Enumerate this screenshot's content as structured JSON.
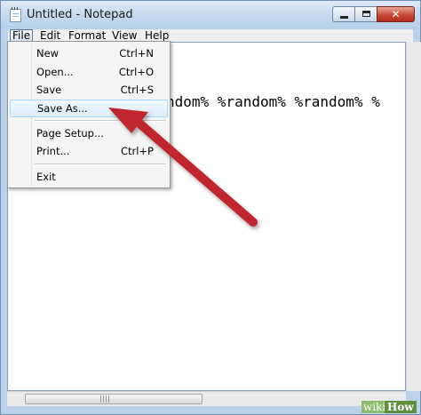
{
  "window": {
    "title": "Untitled - Notepad",
    "icon": "notepad-icon"
  },
  "title_buttons": {
    "minimize_icon": "minimize-icon",
    "maximize_icon": "maximize-icon",
    "close_glyph": "✕"
  },
  "menubar": {
    "items": [
      "File",
      "Edit",
      "Format",
      "View",
      "Help"
    ],
    "active": "File"
  },
  "file_menu": {
    "items": [
      {
        "label": "New",
        "shortcut": "Ctrl+N"
      },
      {
        "label": "Open...",
        "shortcut": "Ctrl+O"
      },
      {
        "label": "Save",
        "shortcut": "Ctrl+S"
      },
      {
        "label": "Save As...",
        "shortcut": ""
      },
      {
        "label": "Page Setup...",
        "shortcut": ""
      },
      {
        "label": "Print...",
        "shortcut": "Ctrl+P"
      },
      {
        "label": "Exit",
        "shortcut": ""
      }
    ],
    "highlighted": "Save As..."
  },
  "editor": {
    "visible_text": "ndom% %random% %random% %"
  },
  "annotation": {
    "arrow_color": "#c0282e",
    "points_to": "Save As..."
  },
  "watermark": {
    "wiki": "wiki",
    "how": "How"
  },
  "colors": {
    "title_bar": "#c7dbf1",
    "close_button": "#c84a36",
    "menu_highlight": "#dcebfc"
  }
}
